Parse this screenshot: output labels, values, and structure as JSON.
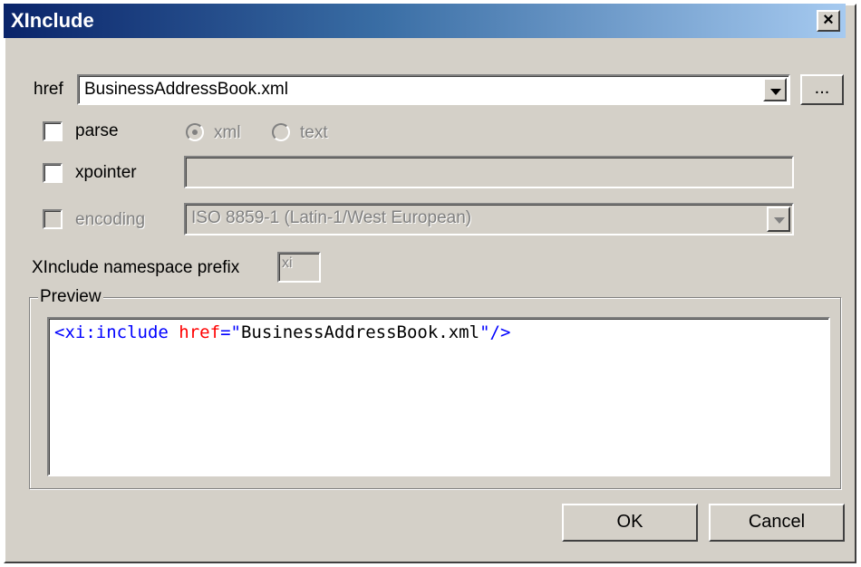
{
  "window": {
    "title": "XInclude",
    "close_label": "×"
  },
  "href": {
    "label": "href",
    "value": "BusinessAddressBook.xml",
    "browse_label": "..."
  },
  "parse": {
    "label": "parse",
    "checked": false,
    "options": [
      "xml",
      "text"
    ],
    "selected": "xml"
  },
  "xpointer": {
    "label": "xpointer",
    "checked": false,
    "value": ""
  },
  "encoding": {
    "label": "encoding",
    "checked": false,
    "value": "ISO 8859-1 (Latin-1/West European)"
  },
  "namespace": {
    "label": "XInclude namespace prefix",
    "value": "xi"
  },
  "preview": {
    "label": "Preview",
    "code": {
      "open": "<",
      "tag": "xi:include",
      "attr": "href",
      "eq": "=",
      "quote_open": "\"",
      "value": "BusinessAddressBook.xml",
      "quote_close": "\"",
      "close": "/>"
    },
    "colors": {
      "tag": "#0000ff",
      "attr": "#ff0000",
      "value": "#000000"
    }
  },
  "buttons": {
    "ok": "OK",
    "cancel": "Cancel"
  }
}
